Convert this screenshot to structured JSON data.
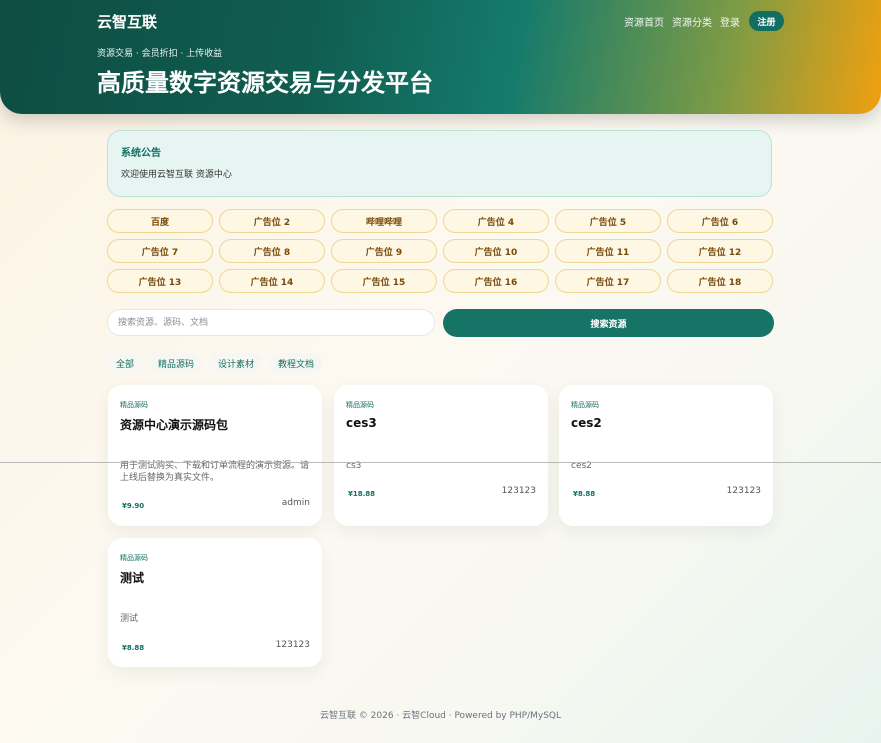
{
  "header": {
    "brand": "云智互联",
    "subtitle": "资源交易 · 会员折扣 · 上传收益",
    "title": "高质量数字资源交易与分发平台",
    "nav": {
      "home": "资源首页",
      "categories": "资源分类",
      "login": "登录",
      "register": "注册"
    }
  },
  "notice": {
    "title": "系统公告",
    "text": "欢迎使用云智互联 资源中心"
  },
  "ads": [
    "百度",
    "广告位 2",
    "哔哩哔哩",
    "广告位 4",
    "广告位 5",
    "广告位 6",
    "广告位 7",
    "广告位 8",
    "广告位 9",
    "广告位 10",
    "广告位 11",
    "广告位 12",
    "广告位 13",
    "广告位 14",
    "广告位 15",
    "广告位 16",
    "广告位 17",
    "广告位 18"
  ],
  "search": {
    "placeholder": "搜索资源、源码、文档",
    "button": "搜索资源"
  },
  "categories": [
    "全部",
    "精品源码",
    "设计素材",
    "教程文档"
  ],
  "cards": [
    {
      "tag": "精品源码",
      "title": "资源中心演示源码包",
      "desc": "用于测试购买、下载和订单流程的演示资源。请上线后替换为真实文件。",
      "price": "¥9.90",
      "author": "admin"
    },
    {
      "tag": "精品源码",
      "title": "ces3",
      "desc": "cs3",
      "price": "¥18.88",
      "author": "123123"
    },
    {
      "tag": "精品源码",
      "title": "ces2",
      "desc": "ces2",
      "price": "¥8.88",
      "author": "123123"
    },
    {
      "tag": "精品源码",
      "title": "测试",
      "desc": "测试",
      "price": "¥8.88",
      "author": "123123"
    }
  ],
  "footer": "云智互联 © 2026 · 云智Cloud · Powered by PHP/MySQL",
  "colors": {
    "accent": "#136e62",
    "hero_start": "#0e4d42",
    "hero_end": "#f0a00f",
    "ad_border": "#f1d690",
    "ad_text": "#7a4a0b"
  }
}
